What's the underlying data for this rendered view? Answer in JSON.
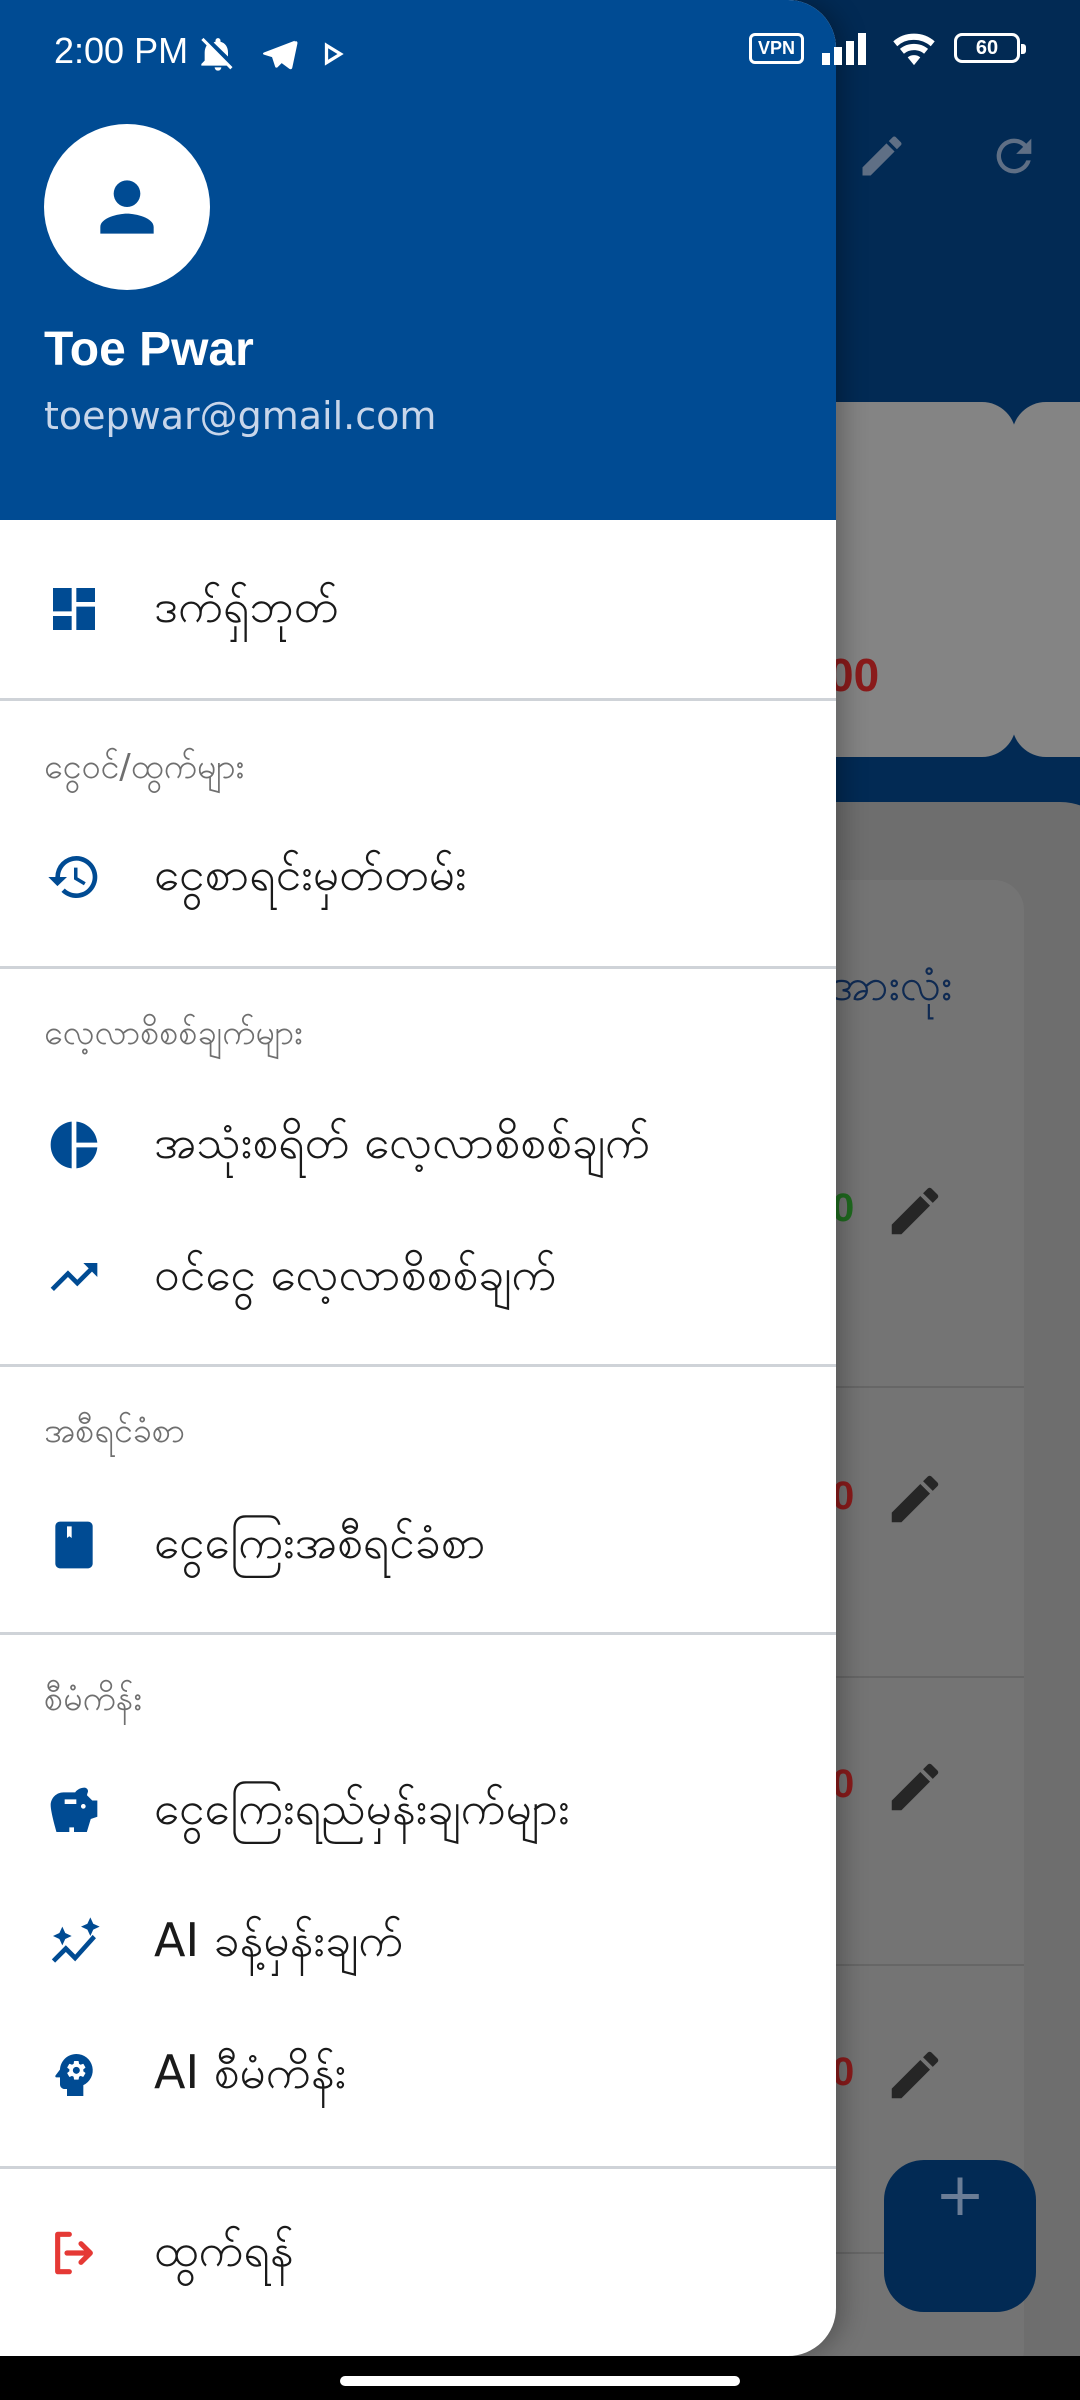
{
  "status_bar": {
    "time": "2:00 PM",
    "vpn": "VPN",
    "battery": "60"
  },
  "background": {
    "summary_amount": "00",
    "list_header": "အားလုံး",
    "row_amounts": [
      {
        "text": "0",
        "color": "#1f6b1f"
      },
      {
        "text": "0",
        "color": "#8a1b1b"
      },
      {
        "text": "0",
        "color": "#8a1b1b"
      },
      {
        "text": "0",
        "color": "#8a1b1b"
      }
    ],
    "fab_label": "+"
  },
  "drawer": {
    "user": {
      "name": "Toe Pwar",
      "email": "toepwar@gmail.com"
    },
    "sections": [
      {
        "label": "ငွေဝင်/ထွက်များ"
      },
      {
        "label": "လေ့လာစိစစ်ချက်များ"
      },
      {
        "label": "အစီရင်ခံစာ"
      },
      {
        "label": "စီမံကိန်း"
      }
    ],
    "items": [
      {
        "label": "ဒက်ရှ်ဘုတ်",
        "icon": "dashboard-icon"
      },
      {
        "label": "ငွေစာရင်းမှတ်တမ်း",
        "icon": "history-icon"
      },
      {
        "label": "အသုံးစရိတ် လေ့လာစိစစ်ချက်",
        "icon": "pie-chart-icon"
      },
      {
        "label": "ဝင်ငွေ လေ့လာစိစစ်ချက်",
        "icon": "trending-up-icon"
      },
      {
        "label": "ငွေကြေးအစီရင်ခံစာ",
        "icon": "book-icon"
      },
      {
        "label": "ငွေကြေးရည်မှန်းချက်များ",
        "icon": "piggy-bank-icon"
      },
      {
        "label": "AI ခန့်မှန်းချက်",
        "icon": "ai-forecast-icon"
      },
      {
        "label": "AI စီမံကိန်း",
        "icon": "ai-planning-icon"
      },
      {
        "label": "ထွက်ရန်",
        "icon": "logout-icon"
      }
    ],
    "accent_color": "#004b93",
    "logout_color": "#e53935"
  }
}
